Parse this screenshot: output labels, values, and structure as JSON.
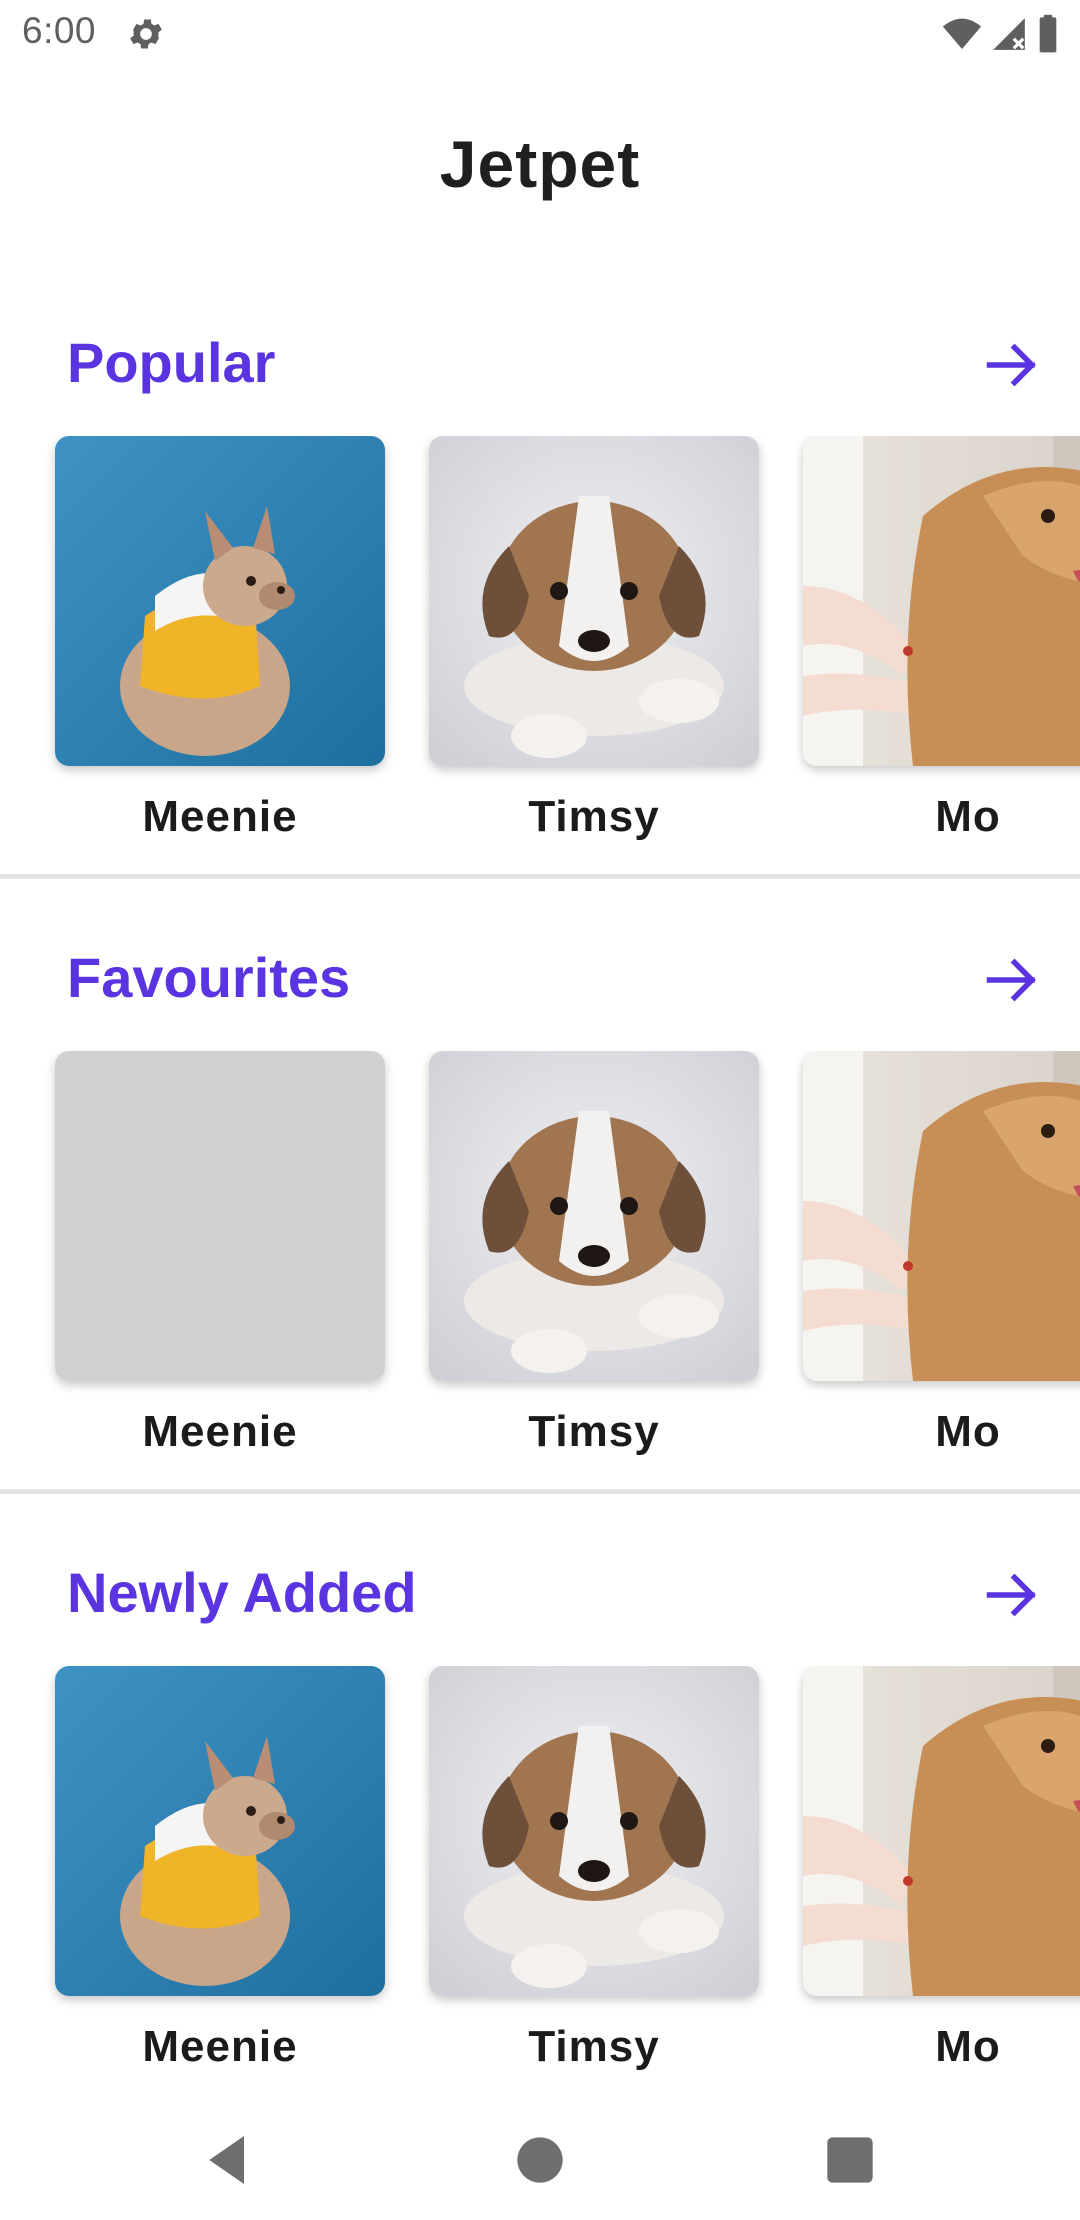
{
  "status_bar": {
    "time": "6:00",
    "icons": [
      "gear-icon",
      "wifi-icon",
      "signal-icon",
      "battery-icon"
    ]
  },
  "app": {
    "title": "Jetpet"
  },
  "colors": {
    "accent": "#5a34e0",
    "text": "#1b1b1b",
    "divider": "#e3e3e3",
    "placeholder": "#d0d0d0"
  },
  "sections": [
    {
      "title": "Popular",
      "arrow_icon": "arrow-right-icon",
      "pets": [
        {
          "name": "Meenie",
          "image": "french-bulldog-photo"
        },
        {
          "name": "Timsy",
          "image": "puppy-photo"
        },
        {
          "name": "Mo",
          "image": "golden-retriever-photo"
        }
      ]
    },
    {
      "title": "Favourites",
      "arrow_icon": "arrow-right-icon",
      "pets": [
        {
          "name": "Meenie",
          "image": "image-placeholder"
        },
        {
          "name": "Timsy",
          "image": "puppy-photo"
        },
        {
          "name": "Mo",
          "image": "golden-retriever-photo"
        }
      ]
    },
    {
      "title": "Newly Added",
      "arrow_icon": "arrow-right-icon",
      "pets": [
        {
          "name": "Meenie",
          "image": "french-bulldog-photo"
        },
        {
          "name": "Timsy",
          "image": "puppy-photo"
        },
        {
          "name": "Mo",
          "image": "golden-retriever-photo"
        }
      ]
    }
  ],
  "nav_bar": {
    "buttons": [
      "back-icon",
      "home-icon",
      "recents-icon"
    ]
  }
}
